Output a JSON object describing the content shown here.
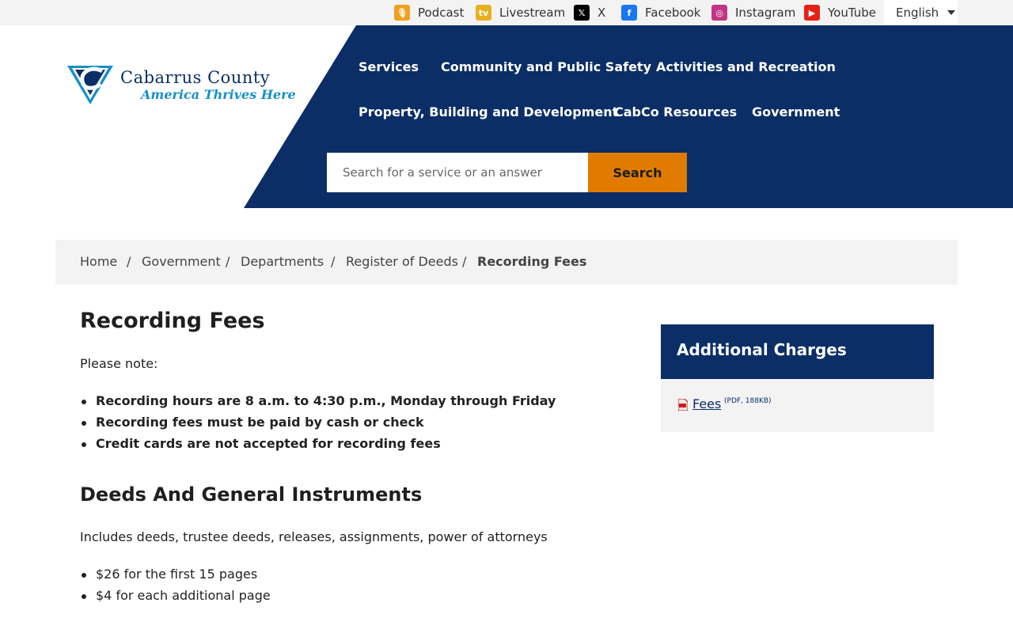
{
  "topbar": {
    "links": [
      {
        "label": "Podcast",
        "icon": "podcast-icon",
        "color": "#f0a020"
      },
      {
        "label": "Livestream",
        "icon": "livestream-icon",
        "color": "#e8b020"
      },
      {
        "label": "X",
        "icon": "x-icon",
        "color": "#000000"
      },
      {
        "label": "Facebook",
        "icon": "facebook-icon",
        "color": "#1877f2"
      },
      {
        "label": "Instagram",
        "icon": "instagram-icon",
        "color": "#c13584"
      },
      {
        "label": "YouTube",
        "icon": "youtube-icon",
        "color": "#e62117"
      }
    ],
    "language": "English"
  },
  "logo": {
    "title": "Cabarrus County",
    "tagline": "America Thrives Here"
  },
  "nav": {
    "items": [
      "Services",
      "Community and Public Safety",
      "Activities and Recreation",
      "Property, Building and Development",
      "CabCo Resources",
      "Government"
    ]
  },
  "search": {
    "placeholder": "Search for a service or an answer",
    "button": "Search"
  },
  "breadcrumb": {
    "items": [
      "Home",
      "Government",
      "Departments",
      "Register of Deeds"
    ],
    "current": "Recording Fees"
  },
  "main": {
    "title": "Recording Fees",
    "note": "Please note:",
    "notes": [
      "Recording hours are 8 a.m. to 4:30 p.m., Monday through Friday",
      "Recording fees must be paid by cash or check",
      "Credit cards are not accepted for recording fees"
    ],
    "section_title": "Deeds And General Instruments",
    "section_text": "Includes deeds, trustee deeds, releases, assignments, power of attorneys",
    "section_items": [
      "$26 for the first 15 pages",
      "$4 for each additional page"
    ]
  },
  "sidebar": {
    "title": "Additional Charges",
    "link_label": "Fees",
    "link_meta": "(PDF, 188KB)"
  },
  "colors": {
    "navy": "#0b2e66",
    "accent": "#e07b00",
    "light_gray": "#f3f3f3"
  }
}
